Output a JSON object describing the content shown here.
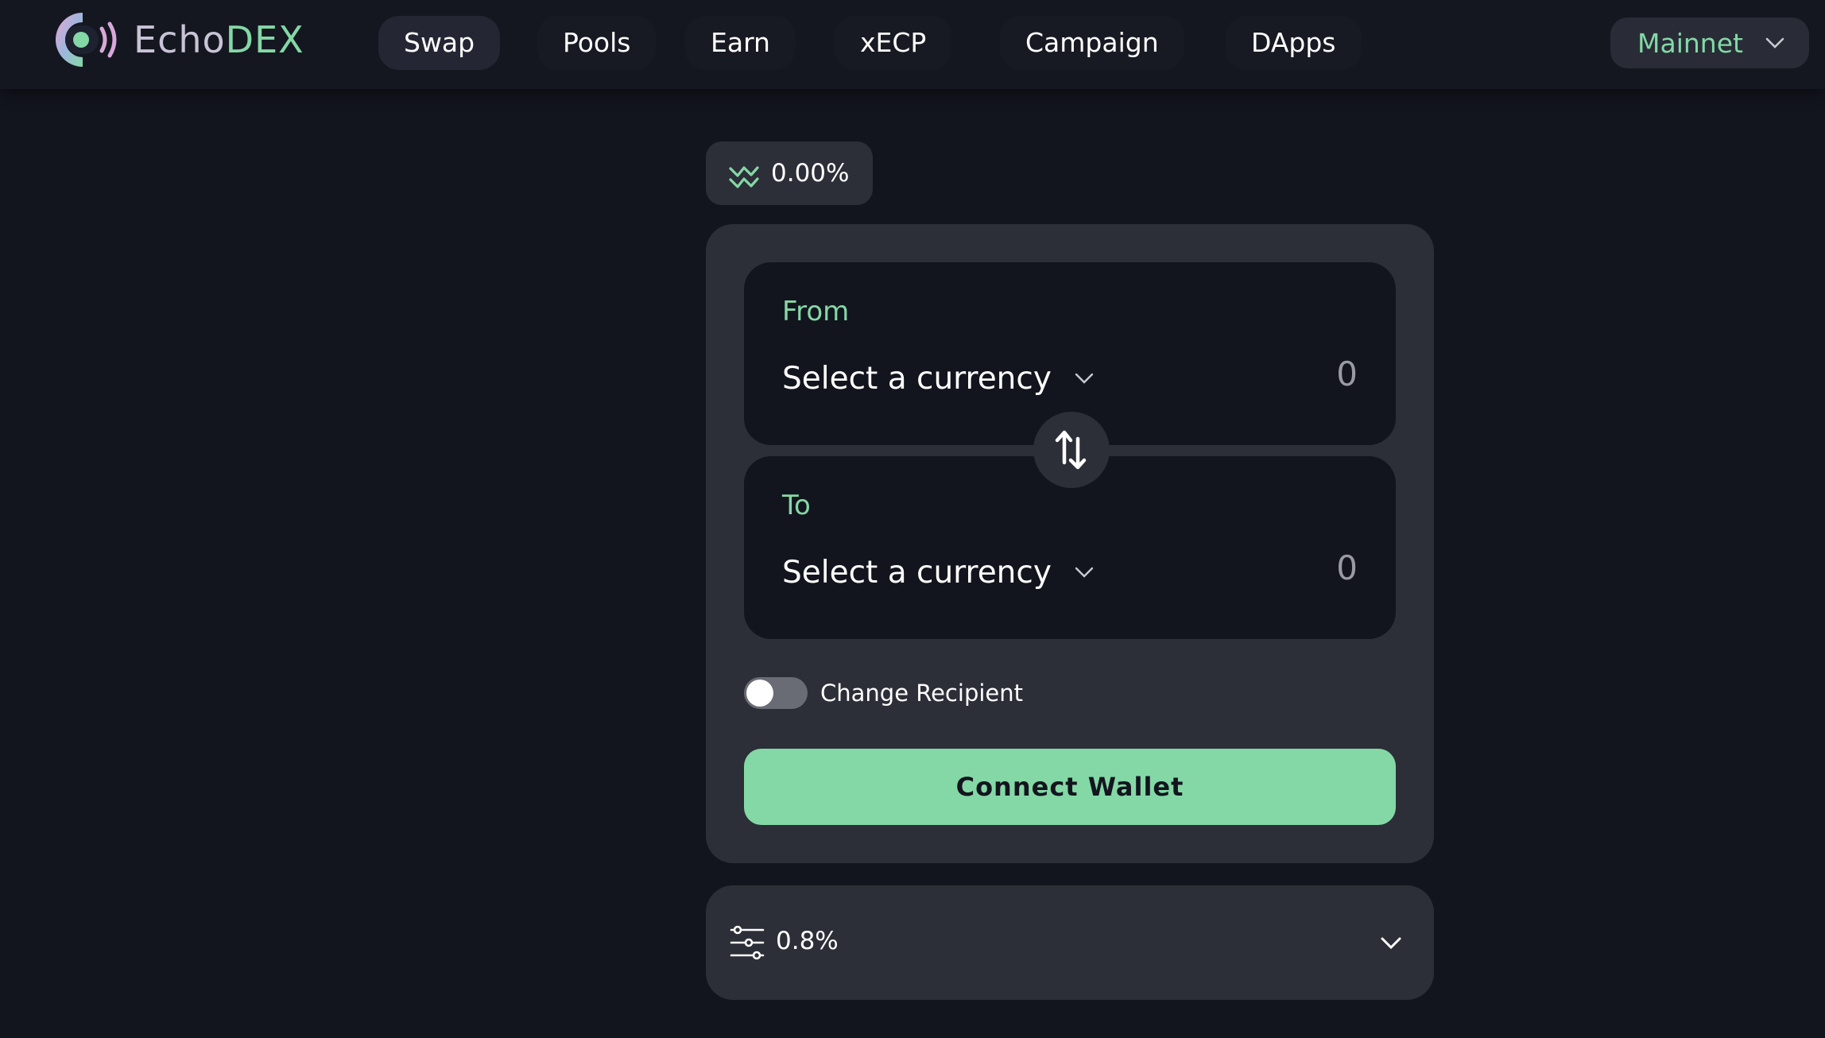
{
  "brand": {
    "name_part1": "Echo",
    "name_part2": "DEX"
  },
  "nav": {
    "items": [
      {
        "label": "Swap",
        "active": true
      },
      {
        "label": "Pools",
        "active": false
      },
      {
        "label": "Earn",
        "active": false
      },
      {
        "label": "xECP",
        "active": false
      },
      {
        "label": "Campaign",
        "active": false
      },
      {
        "label": "DApps",
        "active": false
      }
    ]
  },
  "network": {
    "label": "Mainnet"
  },
  "price_impact": {
    "value": "0.00%"
  },
  "swap": {
    "from": {
      "label": "From",
      "currency": "Select a currency",
      "amount": "0"
    },
    "to": {
      "label": "To",
      "currency": "Select a currency",
      "amount": "0"
    },
    "recipient": {
      "label": "Change Recipient",
      "enabled": false
    },
    "connect_label": "Connect Wallet"
  },
  "slippage": {
    "value": "0.8%"
  },
  "colors": {
    "background": "#13151e",
    "card": "#2c2e38",
    "accent": "#84d8a6",
    "text": "#ffffff",
    "muted": "#9a9aa4"
  },
  "icons": {
    "logo": "echodex-logo-icon",
    "price_impact": "price-impact-icon",
    "swap_direction": "swap-arrows-icon",
    "slippage": "sliders-icon",
    "chevron": "chevron-down-icon"
  }
}
